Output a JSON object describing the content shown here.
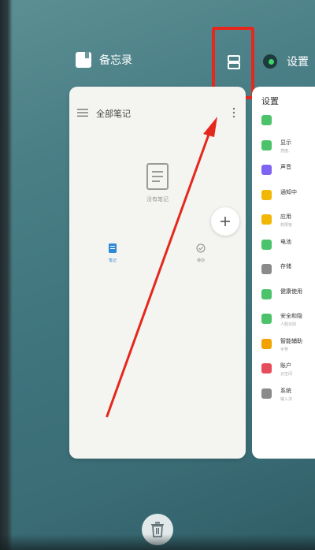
{
  "memo_app": {
    "header_title": "备忘录",
    "card_title": "全部笔记",
    "empty_label": "没有笔记",
    "tabs": [
      {
        "label": "笔记"
      },
      {
        "label": "待办"
      }
    ]
  },
  "settings_app": {
    "header_title": "设置",
    "card_title": "设置",
    "items": [
      {
        "title": "",
        "subtitle": "",
        "color": "#4cc36a"
      },
      {
        "title": "显示",
        "subtitle": "亮度、",
        "color": "#4cc36a"
      },
      {
        "title": "声音",
        "subtitle": "",
        "color": "#7f63f3"
      },
      {
        "title": "通知中",
        "subtitle": "",
        "color": "#f2b705"
      },
      {
        "title": "应用",
        "subtitle": "权限管",
        "color": "#f2b705"
      },
      {
        "title": "电池",
        "subtitle": "",
        "color": "#4cc36a"
      },
      {
        "title": "存储",
        "subtitle": "",
        "color": "#8a8a8a"
      },
      {
        "title": "健康使用",
        "subtitle": "",
        "color": "#4cc36a"
      },
      {
        "title": "安全和隐",
        "subtitle": "人脸识别",
        "color": "#4cc36a"
      },
      {
        "title": "智能辅助",
        "subtitle": "手势",
        "color": "#f2a200"
      },
      {
        "title": "账户",
        "subtitle": "云空间",
        "color": "#e74c5b"
      },
      {
        "title": "系统",
        "subtitle": "输入法",
        "color": "#8a8a8a"
      }
    ]
  },
  "colors": {
    "highlight": "#e5281d",
    "accent_blue": "#2f88d6"
  },
  "icons": {
    "split_screen": "split-screen-icon",
    "clear_all": "trash-icon",
    "add": "plus-icon",
    "menu": "hamburger-icon",
    "more": "more-vertical-icon"
  }
}
